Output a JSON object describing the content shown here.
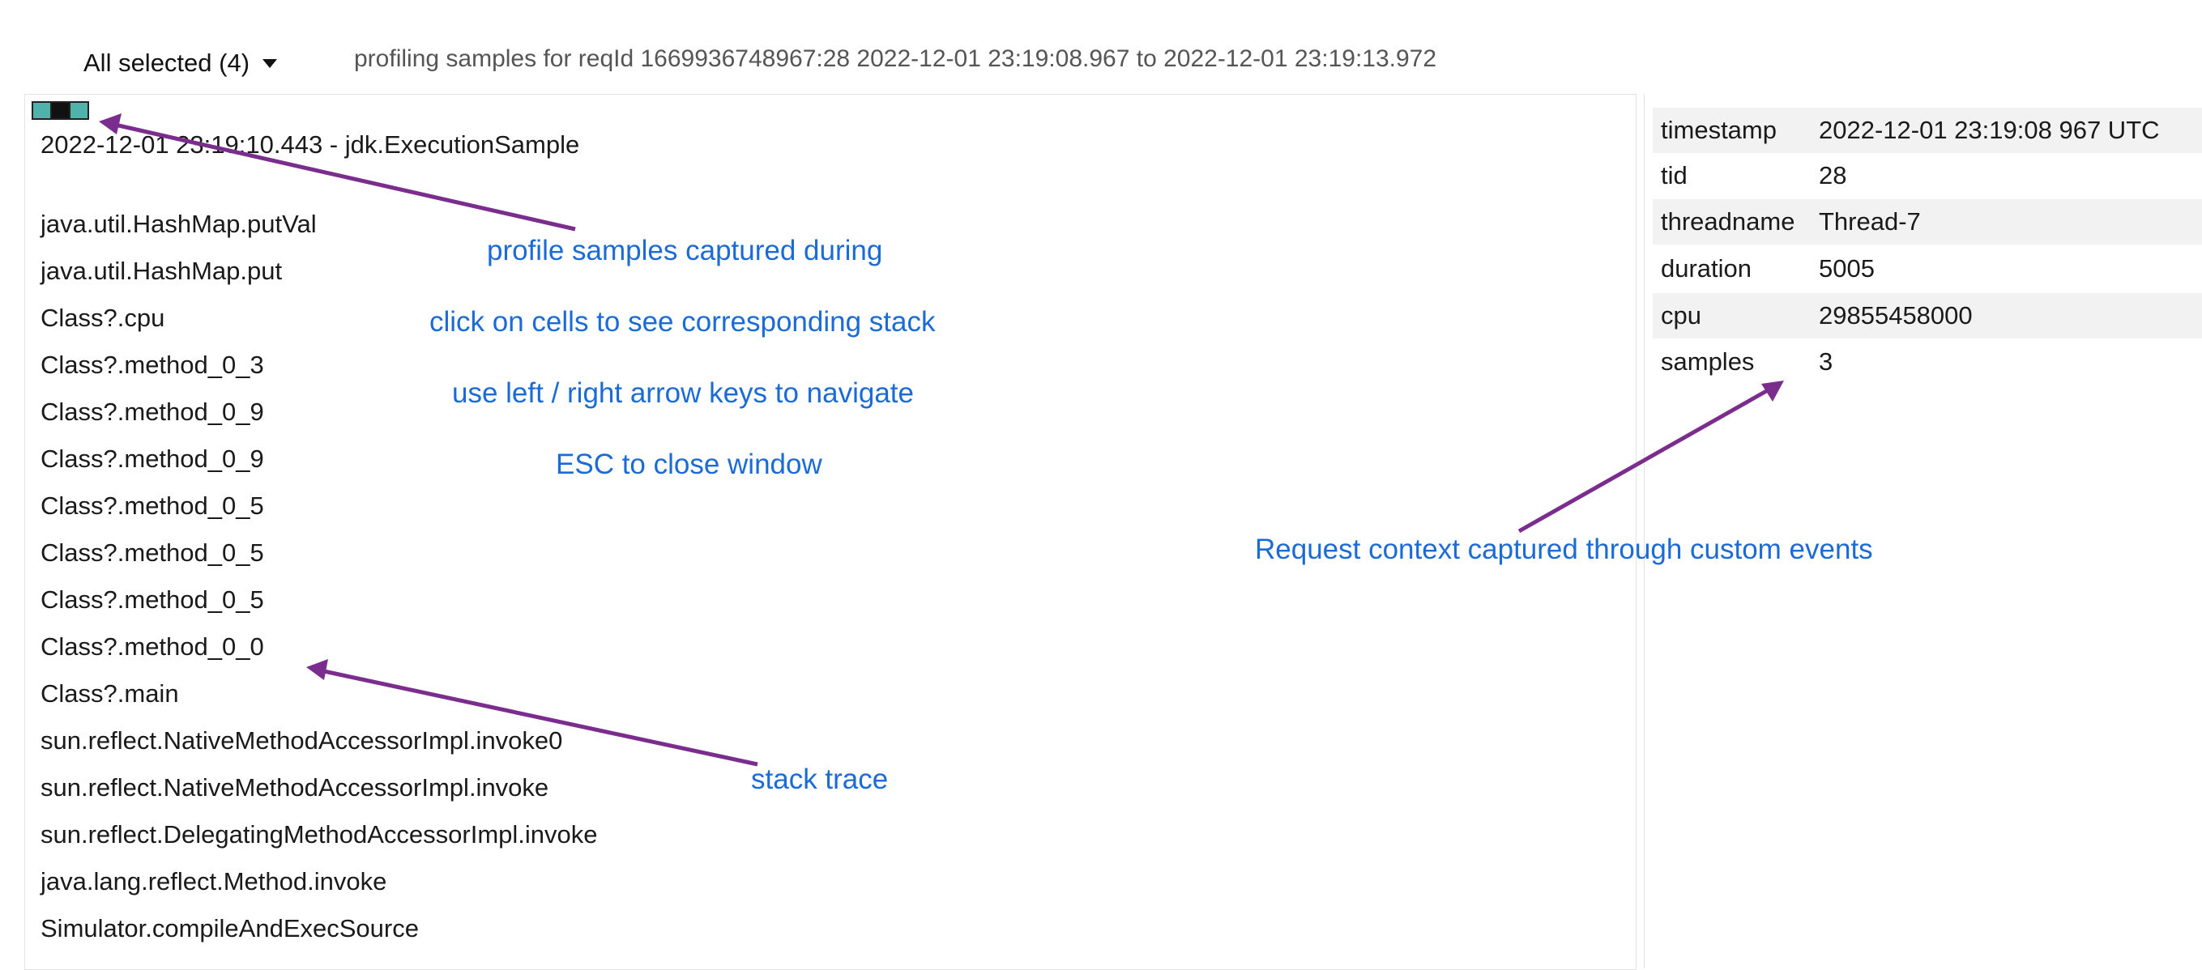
{
  "header": {
    "filter_label": "All selected (4)",
    "info": "profiling samples for reqId 1669936748967:28 2022-12-01 23:19:08.967 to 2022-12-01 23:19:13.972"
  },
  "stack": {
    "sample_colors": [
      "#4fb3ac",
      "#111111",
      "#4fb3ac"
    ],
    "title": "2022-12-01 23:19:10.443 - jdk.ExecutionSample",
    "frames": [
      "java.util.HashMap.putVal",
      "java.util.HashMap.put",
      "Class?.cpu",
      "Class?.method_0_3",
      "Class?.method_0_9",
      "Class?.method_0_9",
      "Class?.method_0_5",
      "Class?.method_0_5",
      "Class?.method_0_5",
      "Class?.method_0_0",
      "Class?.main",
      "sun.reflect.NativeMethodAccessorImpl.invoke0",
      "sun.reflect.NativeMethodAccessorImpl.invoke",
      "sun.reflect.DelegatingMethodAccessorImpl.invoke",
      "java.lang.reflect.Method.invoke",
      "Simulator.compileAndExecSource"
    ]
  },
  "context": {
    "rows": [
      {
        "key": "timestamp",
        "value": "2022-12-01 23:19:08 967 UTC"
      },
      {
        "key": "tid",
        "value": "28"
      },
      {
        "key": "threadname",
        "value": "Thread-7"
      },
      {
        "key": "duration",
        "value": "5005"
      },
      {
        "key": "cpu",
        "value": "29855458000"
      },
      {
        "key": "samples",
        "value": "3"
      }
    ]
  },
  "annotations": {
    "samples_note": "profile samples captured during",
    "click_note": "click on cells to see corresponding stack",
    "arrows_note": "use left / right arrow keys to navigate",
    "esc_note": "ESC to close window",
    "context_note": "Request context captured through custom events",
    "stack_note": "stack trace"
  },
  "colors": {
    "annotation_text": "#1b6bd6",
    "arrow": "#7b2d8e",
    "row_alt": "#f2f2f2"
  }
}
